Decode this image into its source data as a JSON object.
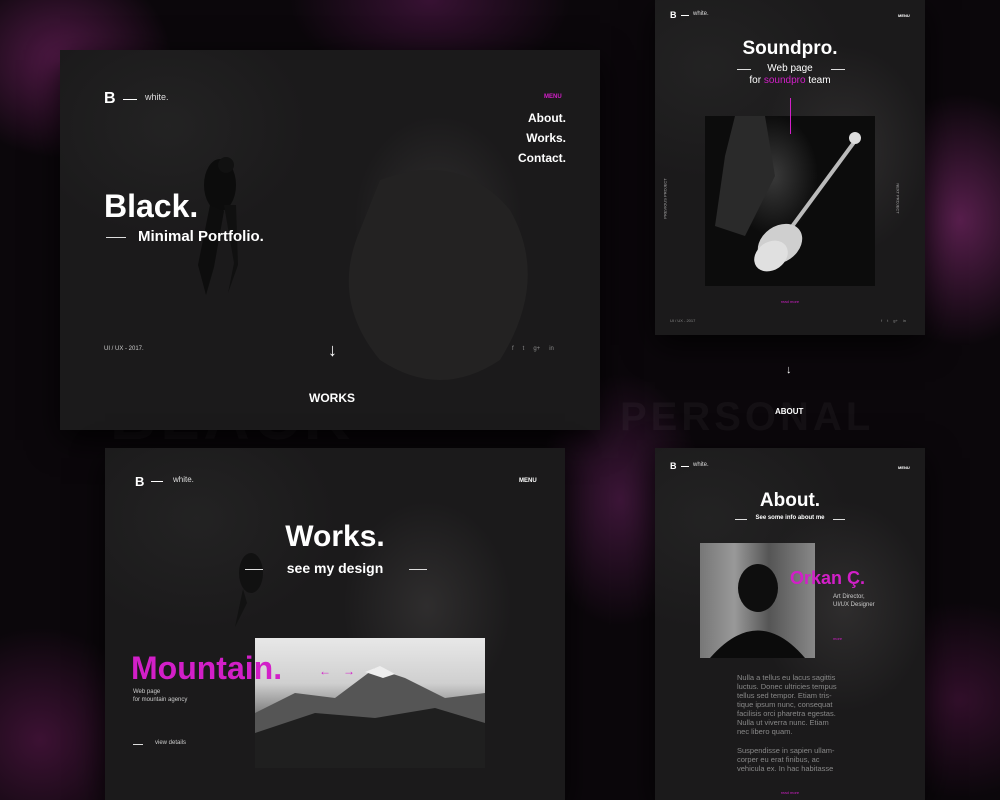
{
  "colors": {
    "accent": "#d21fc8",
    "panel": "#1b1a1b",
    "background": "#0b070b"
  },
  "main": {
    "logo_letter": "B",
    "logo_word": "white.",
    "menu_label": "MENU",
    "nav": [
      "About.",
      "Works.",
      "Contact."
    ],
    "hero_title": "Black.",
    "hero_subtitle": "Minimal Portfolio.",
    "meta": "UI / UX - 2017.",
    "scroll_arrow": "↓",
    "social": [
      "f",
      "t",
      "g+",
      "in"
    ],
    "section_label": "WORKS"
  },
  "works": {
    "logo_letter": "B",
    "logo_word": "white.",
    "menu_label": "MENU",
    "title": "Works.",
    "subtitle": "see my design",
    "project_title": "Mountain.",
    "project_desc_1": "Web page",
    "project_desc_2": "for mountain agency",
    "prev_arrow": "←",
    "next_arrow": "→",
    "view_details": "view details"
  },
  "soundpro": {
    "logo_letter": "B",
    "logo_word": "white.",
    "menu_label": "MENU",
    "title": "Soundpro.",
    "subtitle_1": "Web page",
    "subtitle_2_prefix": "for ",
    "subtitle_2_accent": "soundpro",
    "subtitle_2_suffix": " team",
    "prev_project": "PREVIOUS PROJECT",
    "next_project": "NEXT PROJECT",
    "view_more": "read more",
    "meta": "UI / UX - 2017",
    "social": [
      "f",
      "t",
      "g+",
      "in"
    ]
  },
  "between": {
    "scroll_arrow": "↓",
    "section_label": "ABOUT"
  },
  "about": {
    "logo_letter": "B",
    "logo_word": "white.",
    "menu_label": "MENU",
    "title": "About.",
    "subtitle": "See some info about me",
    "name": "Orkan Ç.",
    "role_1": "Art Director,",
    "role_2": "UI/UX Designer",
    "link": "more",
    "para1": [
      "Nulla a tellus eu lacus sagittis",
      "luctus. Donec ultricies tempus",
      "tellus sed tempor. Etiam tris-",
      "tique ipsum nunc, consequat",
      "facilisis orci pharetra egestas.",
      "Nulla ut viverra nunc. Etiam",
      "nec libero quam."
    ],
    "para2": [
      "Suspendisse in sapien ullam-",
      "corper eu erat finibus, ac",
      "vehicula ex. In hac habitasse"
    ],
    "footer_link": "read more"
  }
}
